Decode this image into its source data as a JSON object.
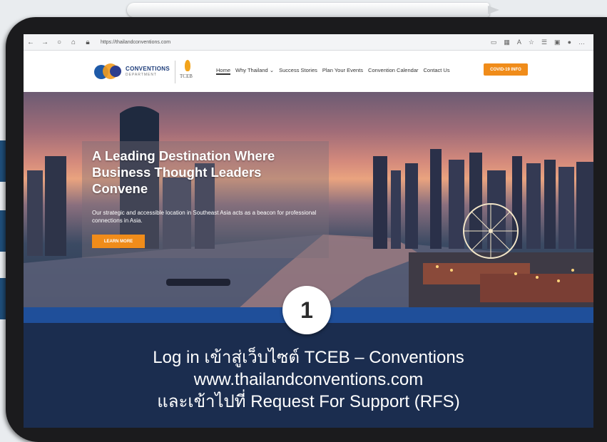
{
  "browser": {
    "url": "https://thailandconventions.com",
    "nav_icons": [
      "back-arrow",
      "forward-arrow",
      "refresh",
      "home"
    ],
    "toolbar_icons": [
      "reader-view",
      "grid",
      "translate",
      "favorite-star",
      "favorites-list",
      "collections",
      "profile",
      "more"
    ]
  },
  "site": {
    "logo_text": "CONVENTIONS",
    "logo_subtext": "DEPARTMENT",
    "partner_logo_text": "TCEB",
    "menu": [
      {
        "label": "Home",
        "active": true
      },
      {
        "label": "Why Thailand ⌄"
      },
      {
        "label": "Success Stories"
      },
      {
        "label": "Plan Your Events"
      },
      {
        "label": "Convention Calendar"
      },
      {
        "label": "Contact Us"
      }
    ],
    "covid_button": "COVID-19 INFO"
  },
  "hero": {
    "title": "A Leading Destination Where Business Thought Leaders Convene",
    "subtitle": "Our strategic and accessible location in Southeast Asia acts as a beacon for professional connections in Asia.",
    "cta": "LEARN MORE"
  },
  "step": {
    "number": "1",
    "caption_line1": "Log in เข้าสู่เว็บไซต์ TCEB – Conventions",
    "caption_line2": "www.thailandconventions.com",
    "caption_line3": "และเข้าไปที่ Request For Support (RFS)"
  },
  "colors": {
    "accent_orange": "#f08c1a",
    "band_blue": "#1f4f9a",
    "panel_navy": "#1b2d4f"
  }
}
